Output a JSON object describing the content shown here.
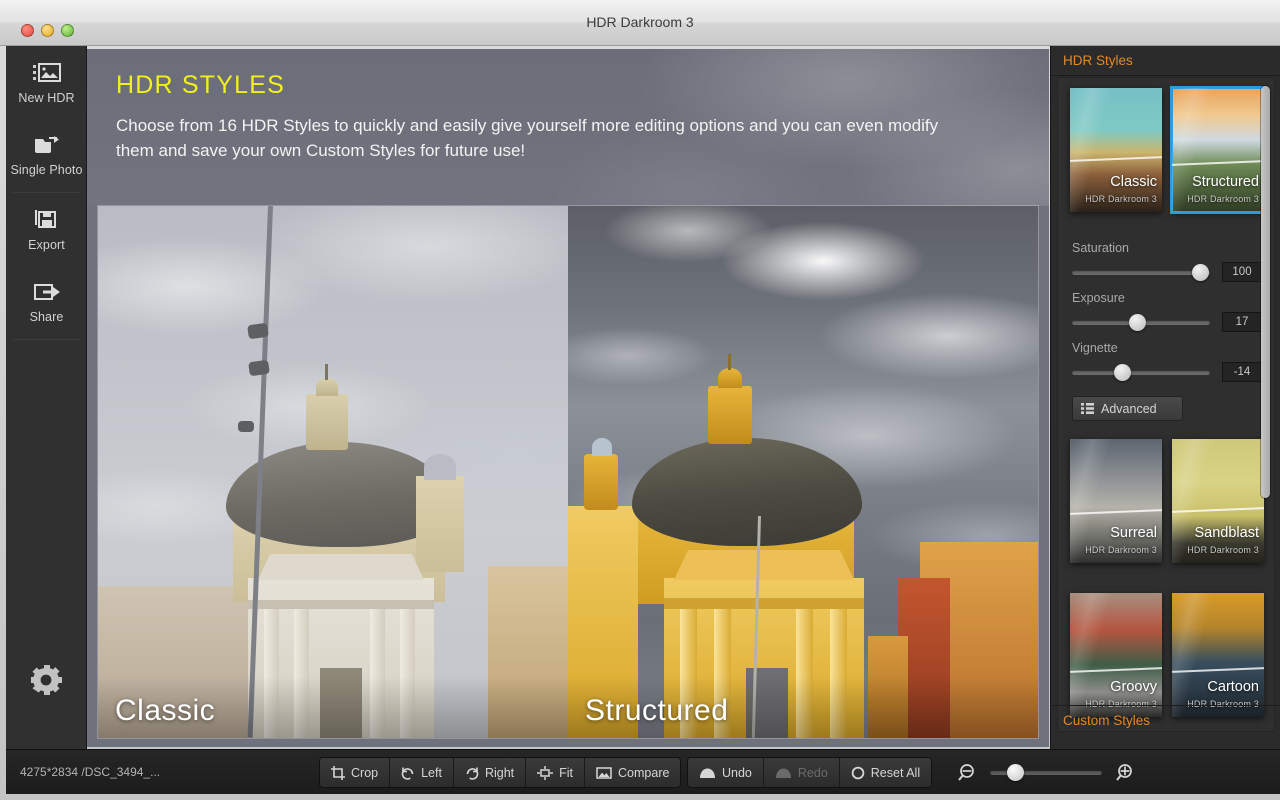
{
  "window": {
    "title": "HDR Darkroom 3",
    "traffic_lights": [
      "close",
      "minimize",
      "maximize"
    ]
  },
  "sidebar": {
    "items": [
      {
        "label": "New HDR",
        "icon": "new-hdr-icon"
      },
      {
        "label": "Single Photo",
        "icon": "single-photo-icon"
      },
      {
        "label": "Export",
        "icon": "export-icon"
      },
      {
        "label": "Share",
        "icon": "share-icon"
      }
    ],
    "settings": {
      "icon": "gear-icon"
    }
  },
  "canvas": {
    "banner": {
      "title": "HDR STYLES",
      "title_color": "#f2f01c",
      "subtitle": "Choose from 16 HDR Styles to quickly and easily give yourself more editing options and you can even modify them and save your own Custom Styles for future use!"
    },
    "comparison": {
      "left_label": "Classic",
      "right_label": "Structured"
    }
  },
  "right_panel": {
    "header": "HDR Styles",
    "custom_styles_header": "Custom Styles",
    "styles": [
      {
        "name": "Classic",
        "sub": "HDR Darkroom 3",
        "selected": false
      },
      {
        "name": "Structured",
        "sub": "HDR Darkroom 3",
        "selected": true
      },
      {
        "name": "Surreal",
        "sub": "HDR Darkroom 3",
        "selected": false
      },
      {
        "name": "Sandblast",
        "sub": "HDR Darkroom 3",
        "selected": false
      },
      {
        "name": "Groovy",
        "sub": "HDR Darkroom 3",
        "selected": false
      },
      {
        "name": "Cartoon",
        "sub": "HDR Darkroom 3",
        "selected": false
      }
    ],
    "sliders": [
      {
        "label": "Saturation",
        "value": "100",
        "percent": 93
      },
      {
        "label": "Exposure",
        "value": "17",
        "percent": 47
      },
      {
        "label": "Vignette",
        "value": "-14",
        "percent": 36
      }
    ],
    "advanced_button": "Advanced",
    "accent_color": "#e08a2a",
    "selection_color": "#2d9ae0"
  },
  "bottom_bar": {
    "status": "4275*2834 /DSC_3494_...",
    "edit_tools": [
      {
        "label": "Crop",
        "icon": "crop-icon",
        "disabled": false
      },
      {
        "label": "Left",
        "icon": "rotate-left-icon",
        "disabled": false
      },
      {
        "label": "Right",
        "icon": "rotate-right-icon",
        "disabled": false
      },
      {
        "label": "Fit",
        "icon": "fit-icon",
        "disabled": false
      },
      {
        "label": "Compare",
        "icon": "compare-icon",
        "disabled": false
      }
    ],
    "history_tools": [
      {
        "label": "Undo",
        "icon": "undo-icon",
        "disabled": false
      },
      {
        "label": "Redo",
        "icon": "redo-icon",
        "disabled": true
      },
      {
        "label": "Reset All",
        "icon": "reset-icon",
        "disabled": false
      }
    ],
    "zoom": {
      "out_icon": "zoom-out-icon",
      "in_icon": "zoom-in-icon",
      "percent": 22
    }
  }
}
